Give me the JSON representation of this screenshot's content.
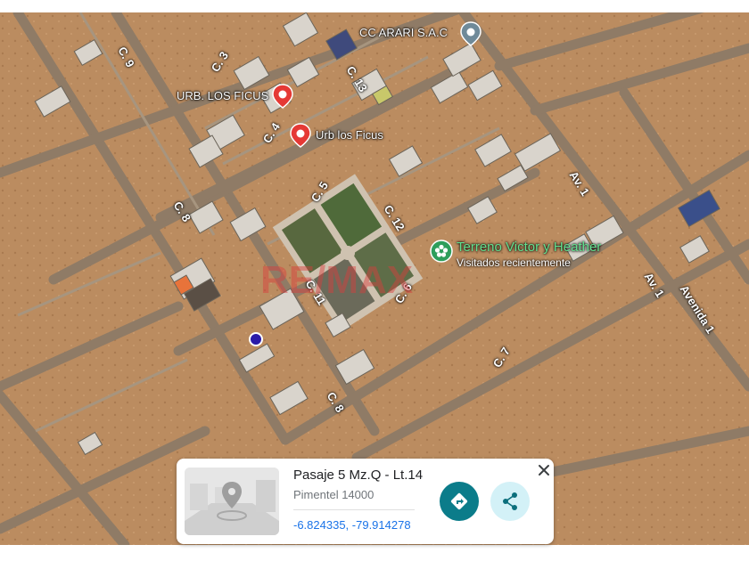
{
  "streets": [
    {
      "id": "c9",
      "text": "C. 9"
    },
    {
      "id": "c3",
      "text": "C. 3"
    },
    {
      "id": "c13",
      "text": "C. 13"
    },
    {
      "id": "c4",
      "text": "C. 4"
    },
    {
      "id": "c5",
      "text": "C. 5"
    },
    {
      "id": "c12",
      "text": "C. 12"
    },
    {
      "id": "c8a",
      "text": "C. 8"
    },
    {
      "id": "c11",
      "text": "C. 11"
    },
    {
      "id": "c6",
      "text": "C. 6"
    },
    {
      "id": "c7",
      "text": "C. 7"
    },
    {
      "id": "c8b",
      "text": "C. 8"
    },
    {
      "id": "av1a",
      "text": "Av. 1"
    },
    {
      "id": "av1b",
      "text": "Av. 1"
    },
    {
      "id": "avenida1",
      "text": "Avenida 1"
    }
  ],
  "places": {
    "arari": {
      "label": "CC ARARI S.A.C"
    },
    "ficus_upper": {
      "label": "URB. LOS FICUS"
    },
    "ficus_lower": {
      "label": "Urb los Ficus"
    },
    "terreno": {
      "label": "Terreno Victor y Heather",
      "sublabel": "Visitados recientemente"
    }
  },
  "watermark": "RE/MAX",
  "card": {
    "title": "Pasaje 5 Mz.Q - Lt.14",
    "subtitle": "Pimentel 14000",
    "coordinates": "-6.824335, -79.914278",
    "directions_icon": "directions-icon",
    "share_icon": "share-icon",
    "close_icon": "close-icon"
  },
  "colors": {
    "terrain": "#b98a5e",
    "road": "#8a7a68",
    "pin_red": "#e53935",
    "pin_gray": "#6f8a99",
    "pin_green": "#2e9e5b",
    "location_dot": "#2a1aa8",
    "directions_button": "#0b7c8a",
    "share_button": "#d3f1f7"
  }
}
